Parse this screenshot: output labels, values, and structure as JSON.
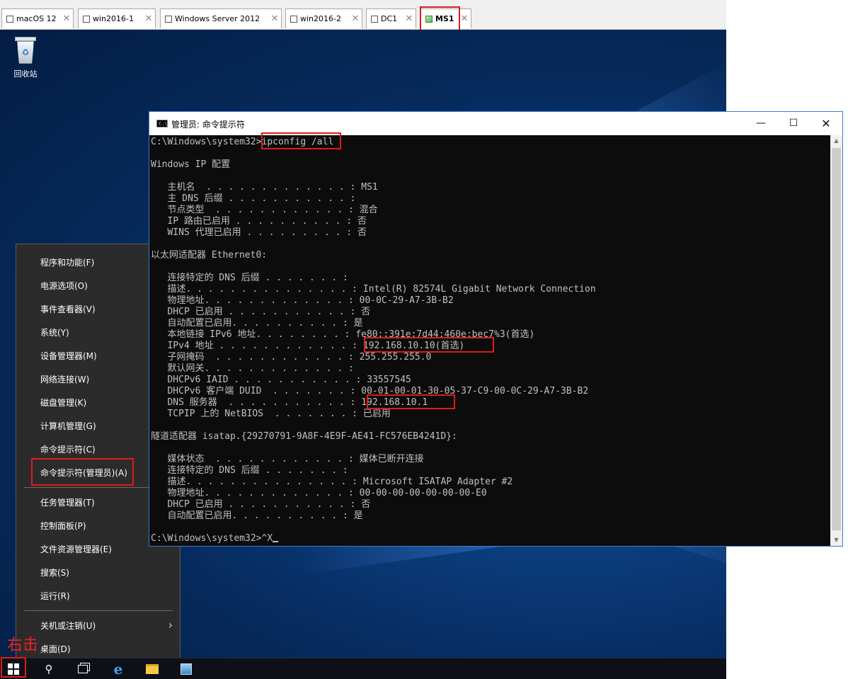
{
  "tabs": [
    {
      "label": "macOS 12"
    },
    {
      "label": "win2016-1"
    },
    {
      "label": "Windows Server 2012"
    },
    {
      "label": "win2016-2"
    },
    {
      "label": "DC1"
    },
    {
      "label": "MS1",
      "active": true
    }
  ],
  "desktop": {
    "recycle_bin_label": "回收站"
  },
  "cmd": {
    "title": "管理员: 命令提示符",
    "lines": [
      "C:\\Windows\\system32>ipconfig /all",
      "",
      "Windows IP 配置",
      "",
      "   主机名  . . . . . . . . . . . . . : MS1",
      "   主 DNS 后缀 . . . . . . . . . . . :",
      "   节点类型  . . . . . . . . . . . . : 混合",
      "   IP 路由已启用 . . . . . . . . . . : 否",
      "   WINS 代理已启用 . . . . . . . . . : 否",
      "",
      "以太网适配器 Ethernet0:",
      "",
      "   连接特定的 DNS 后缀 . . . . . . . :",
      "   描述. . . . . . . . . . . . . . . : Intel(R) 82574L Gigabit Network Connection",
      "   物理地址. . . . . . . . . . . . . : 00-0C-29-A7-3B-B2",
      "   DHCP 已启用 . . . . . . . . . . . : 否",
      "   自动配置已启用. . . . . . . . . . : 是",
      "   本地链接 IPv6 地址. . . . . . . . : fe80::391e:7d44:460e:bec7%3(首选)",
      "   IPv4 地址 . . . . . . . . . . . . : 192.168.10.10(首选)",
      "   子网掩码  . . . . . . . . . . . . : 255.255.255.0",
      "   默认网关. . . . . . . . . . . . . :",
      "   DHCPv6 IAID . . . . . . . . . . . : 33557545",
      "   DHCPv6 客户端 DUID  . . . . . . . : 00-01-00-01-30-05-37-C9-00-0C-29-A7-3B-B2",
      "   DNS 服务器  . . . . . . . . . . . : 192.168.10.1",
      "   TCPIP 上的 NetBIOS  . . . . . . . : 已启用",
      "",
      "隧道适配器 isatap.{29270791-9A8F-4E9F-AE41-FC576EB4241D}:",
      "",
      "   媒体状态  . . . . . . . . . . . . : 媒体已断开连接",
      "   连接特定的 DNS 后缀 . . . . . . . :",
      "   描述. . . . . . . . . . . . . . . : Microsoft ISATAP Adapter #2",
      "   物理地址. . . . . . . . . . . . . : 00-00-00-00-00-00-00-E0",
      "   DHCP 已启用 . . . . . . . . . . . : 否",
      "   自动配置已启用. . . . . . . . . . : 是",
      "",
      "C:\\Windows\\system32>^X"
    ]
  },
  "winx_menu": {
    "items": [
      "程序和功能(F)",
      "电源选项(O)",
      "事件查看器(V)",
      "系统(Y)",
      "设备管理器(M)",
      "网络连接(W)",
      "磁盘管理(K)",
      "计算机管理(G)",
      "命令提示符(C)",
      "命令提示符(管理员)(A)",
      "任务管理器(T)",
      "控制面板(P)",
      "文件资源管理器(E)",
      "搜索(S)",
      "运行(R)",
      "关机或注销(U)",
      "桌面(D)"
    ]
  },
  "annotation": {
    "right_click_note": "右击"
  },
  "colors": {
    "highlight": "#e01a1a",
    "console_bg": "#0c0c0c",
    "console_text": "#c0c0c0",
    "menu_bg": "#2b2b2b"
  },
  "icons": {
    "start": "windows-start-icon",
    "search": "search-icon",
    "task_view": "task-view-icon",
    "ie": "internet-explorer-icon",
    "explorer": "file-explorer-icon",
    "server_manager": "server-manager-icon"
  }
}
